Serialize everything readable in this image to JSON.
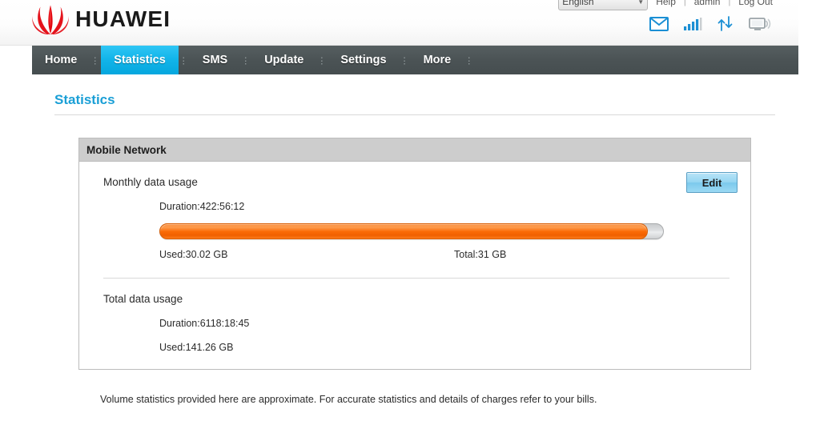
{
  "brand": {
    "name": "HUAWEI",
    "logo_icon": "huawei-flower-logo"
  },
  "utility": {
    "language_value": "English",
    "language_caret_icon": "chevron-down-icon",
    "help_label": "Help",
    "user_label": "admin",
    "logout_label": "Log Out",
    "separator": "|"
  },
  "status_icons": [
    {
      "name": "sms-envelope-icon",
      "title": "SMS"
    },
    {
      "name": "signal-bars-icon",
      "title": "Signal"
    },
    {
      "name": "data-transfer-arrows-icon",
      "title": "Data transfer"
    },
    {
      "name": "connected-device-icon",
      "title": "Connected device"
    }
  ],
  "nav": {
    "items": [
      {
        "label": "Home",
        "active": false
      },
      {
        "label": "Statistics",
        "active": true
      },
      {
        "label": "SMS",
        "active": false
      },
      {
        "label": "Update",
        "active": false
      },
      {
        "label": "Settings",
        "active": false
      },
      {
        "label": "More",
        "active": false
      }
    ],
    "active_color": "#13b5ea",
    "bar_color": "#4b5355"
  },
  "main": {
    "page_title": "Statistics",
    "panel": {
      "header": "Mobile Network",
      "edit_button_label": "Edit",
      "monthly": {
        "title": "Monthly data usage",
        "duration": "Duration:422:56:12",
        "used": "Used:30.02 GB",
        "total": "Total:31 GB",
        "progress_percent": 96.8,
        "fill_color": "#fb6a05"
      },
      "total": {
        "title": "Total data usage",
        "duration": "Duration:6118:18:45",
        "used": "Used:141.26 GB"
      }
    },
    "footnote": "Volume statistics provided here are approximate. For accurate statistics and details of charges refer to your bills."
  }
}
